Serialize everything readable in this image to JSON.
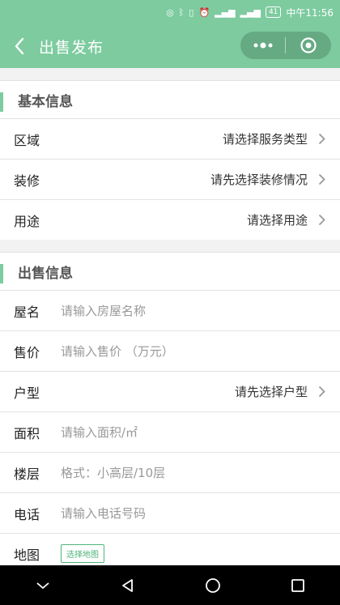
{
  "status_bar": {
    "time": "中午11:56",
    "battery": "41"
  },
  "nav": {
    "title": "出售发布"
  },
  "basic_section": {
    "title": "基本信息",
    "rows": [
      {
        "label": "区域",
        "value": "请选择服务类型"
      },
      {
        "label": "装修",
        "value": "请先选择装修情况"
      },
      {
        "label": "用途",
        "value": "请选择用途"
      }
    ]
  },
  "sale_section": {
    "title": "出售信息",
    "house_name": {
      "label": "屋名",
      "placeholder": "请输入房屋名称"
    },
    "price": {
      "label": "售价",
      "placeholder": "请输入售价 （万元）"
    },
    "layout": {
      "label": "户型",
      "value": "请先选择户型"
    },
    "area": {
      "label": "面积",
      "placeholder": "请输入面积/㎡"
    },
    "floor": {
      "label": "楼层",
      "placeholder": "格式：小高层/10层"
    },
    "phone": {
      "label": "电话",
      "placeholder": "请输入电话号码"
    },
    "map": {
      "label": "地图",
      "button": "选择地图"
    }
  },
  "colors": {
    "accent": "#7dcb9f",
    "map_button": "#4fb47a"
  }
}
